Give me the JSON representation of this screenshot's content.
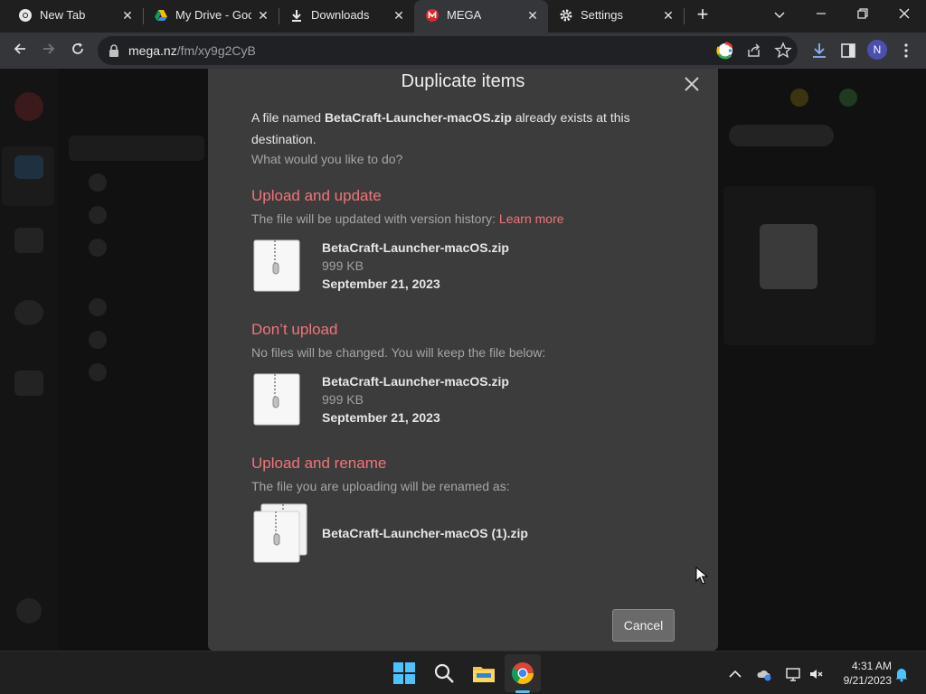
{
  "browser": {
    "tabs": [
      {
        "title": "New Tab",
        "icon": "chrome-icon",
        "active": false
      },
      {
        "title": "My Drive - Goo",
        "icon": "google-drive-icon",
        "active": false
      },
      {
        "title": "Downloads",
        "icon": "download-icon",
        "active": false
      },
      {
        "title": "MEGA",
        "icon": "mega-icon",
        "active": true
      },
      {
        "title": "Settings",
        "icon": "gear-icon",
        "active": false
      }
    ],
    "url_host": "mega.nz",
    "url_path": "/fm/xy9g2CyB",
    "profile_initial": "N"
  },
  "dialog": {
    "title": "Duplicate items",
    "message_prefix": "A file named ",
    "message_file": "BetaCraft-Launcher-macOS.zip",
    "message_suffix": " already exists at this destination.",
    "question": "What would you like to do?",
    "options": [
      {
        "title": "Upload and update",
        "description": "The file will be updated with version history: ",
        "link": "Learn more",
        "file_name": "BetaCraft-Launcher-macOS.zip",
        "file_size": "999 KB",
        "file_date": "September 21, 2023"
      },
      {
        "title": "Don’t upload",
        "description": "No files will be changed. You will keep the file below:",
        "file_name": "BetaCraft-Launcher-macOS.zip",
        "file_size": "999 KB",
        "file_date": "September 21, 2023"
      },
      {
        "title": "Upload and rename",
        "description": "The file you are uploading will be renamed as:",
        "file_name": "BetaCraft-Launcher-macOS (1).zip"
      }
    ],
    "cancel_label": "Cancel"
  },
  "taskbar": {
    "time": "4:31 AM",
    "date": "9/21/2023"
  },
  "colors": {
    "accent": "#f0747a",
    "dialog_bg": "#3c3c3c"
  }
}
